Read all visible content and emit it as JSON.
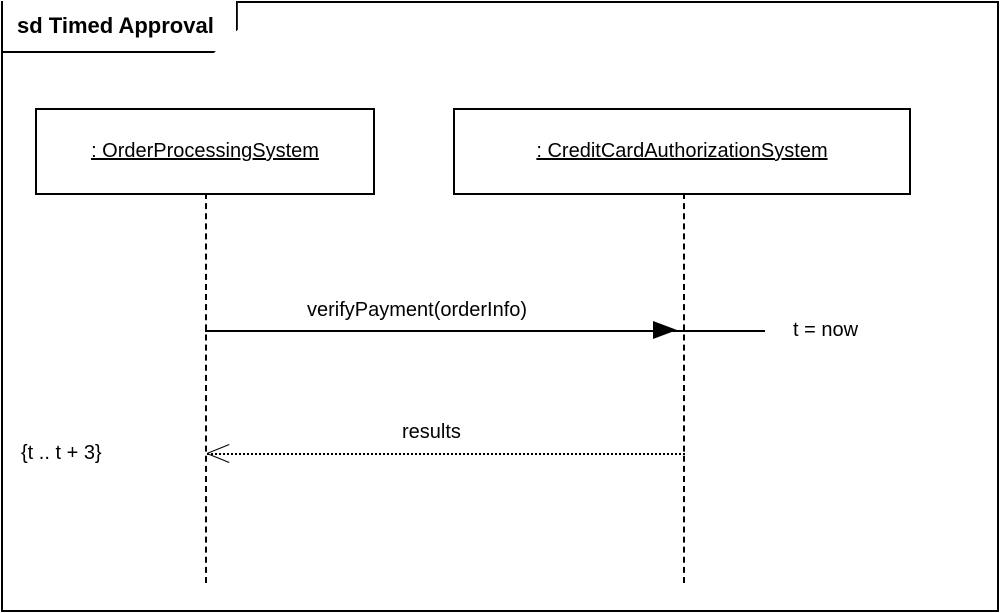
{
  "title": "sd Timed Approval",
  "lifelines": [
    {
      "name": ": OrderProcessingSystem"
    },
    {
      "name": ": CreditCardAuthorizationSystem"
    }
  ],
  "messages": {
    "call": {
      "label": "verifyPayment(orderInfo)",
      "right_note": "t = now"
    },
    "return": {
      "label": "results",
      "left_note": "{t .. t + 3}"
    }
  },
  "chart_data": {
    "type": "sequence-diagram",
    "name": "Timed Approval",
    "lifelines": [
      "OrderProcessingSystem",
      "CreditCardAuthorizationSystem"
    ],
    "interactions": [
      {
        "from": "OrderProcessingSystem",
        "to": "CreditCardAuthorizationSystem",
        "message": "verifyPayment(orderInfo)",
        "type": "sync",
        "timing": "t = now"
      },
      {
        "from": "CreditCardAuthorizationSystem",
        "to": "OrderProcessingSystem",
        "message": "results",
        "type": "return",
        "timing_constraint": "{t .. t + 3}"
      }
    ]
  }
}
